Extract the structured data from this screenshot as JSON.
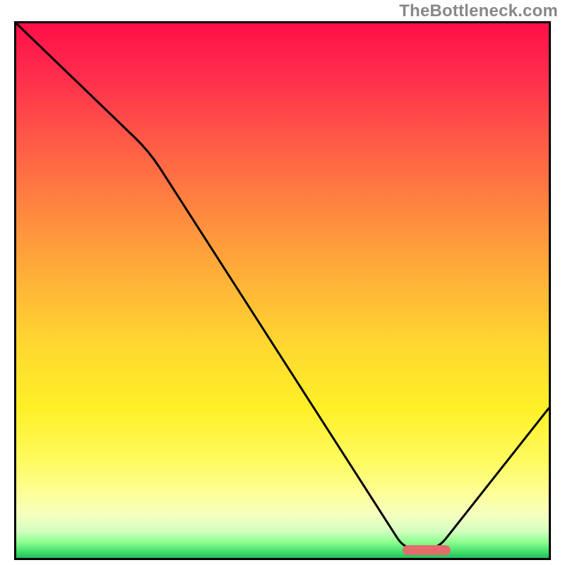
{
  "watermark": "TheBottleneck.com",
  "chart_data": {
    "type": "line",
    "title": "",
    "xlabel": "",
    "ylabel": "",
    "xlim": [
      0,
      100
    ],
    "ylim": [
      0,
      100
    ],
    "grid": false,
    "series": [
      {
        "name": "bottleneck-curve",
        "x": [
          0,
          25,
          73,
          79,
          100
        ],
        "y": [
          100,
          76,
          1.5,
          1.5,
          28
        ],
        "smooth_at": [
          25,
          73,
          79
        ]
      }
    ],
    "annotations": [
      {
        "type": "pill",
        "name": "optimal-marker",
        "x_center": 77,
        "width_pct": 9,
        "color": "#e26b6b"
      }
    ],
    "background": {
      "type": "vertical-gradient",
      "stops": [
        {
          "pct": 0,
          "color": "#ff1048"
        },
        {
          "pct": 10,
          "color": "#ff2e4d"
        },
        {
          "pct": 22,
          "color": "#ff5a47"
        },
        {
          "pct": 35,
          "color": "#ff8740"
        },
        {
          "pct": 48,
          "color": "#ffb238"
        },
        {
          "pct": 60,
          "color": "#ffd730"
        },
        {
          "pct": 72,
          "color": "#fff028"
        },
        {
          "pct": 82,
          "color": "#fffb60"
        },
        {
          "pct": 88,
          "color": "#fdff99"
        },
        {
          "pct": 92,
          "color": "#f4ffc0"
        },
        {
          "pct": 95,
          "color": "#d4ffc0"
        },
        {
          "pct": 97,
          "color": "#90ff90"
        },
        {
          "pct": 99,
          "color": "#3ddc6a"
        },
        {
          "pct": 100,
          "color": "#20c05a"
        }
      ]
    }
  }
}
